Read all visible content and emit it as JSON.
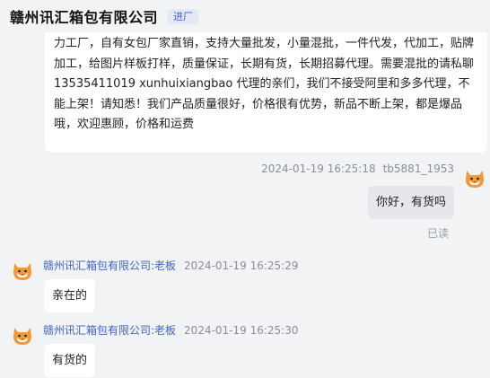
{
  "header": {
    "shop_name": "赣州讯汇箱包有限公司",
    "badge": "进厂"
  },
  "messages": [
    {
      "text": "力工厂，自有女包厂家直销，支持大量批发，小量混批，一件代发，代加工，贴牌加工，给图片样板打样，质量保证，长期有货，长期招募代理。需要混批的请私聊13535411019 xunhuixiangbao 代理的亲们，我们不接受阿里和多多代理，不能上架！请知悉！我们产品质量很好，价格很有优势，新品不断上架，都是爆品哦，欢迎惠顾，价格和运费"
    },
    {
      "timestamp": "2024-01-19 16:25:18",
      "sender": "tb5881_1953",
      "text": "你好，有货吗",
      "status": "已读"
    },
    {
      "sender": "赣州讯汇箱包有限公司:老板",
      "timestamp": "2024-01-19 16:25:29",
      "text": "亲在的"
    },
    {
      "sender": "赣州讯汇箱包有限公司:老板",
      "timestamp": "2024-01-19 16:25:30",
      "text": "有货的"
    }
  ],
  "colors": {
    "background": "#f2f3f5",
    "accent_blue": "#3d63c4",
    "avatar_orange": "#f29a3a"
  },
  "icons": {
    "avatar": "cat-avatar-icon"
  }
}
